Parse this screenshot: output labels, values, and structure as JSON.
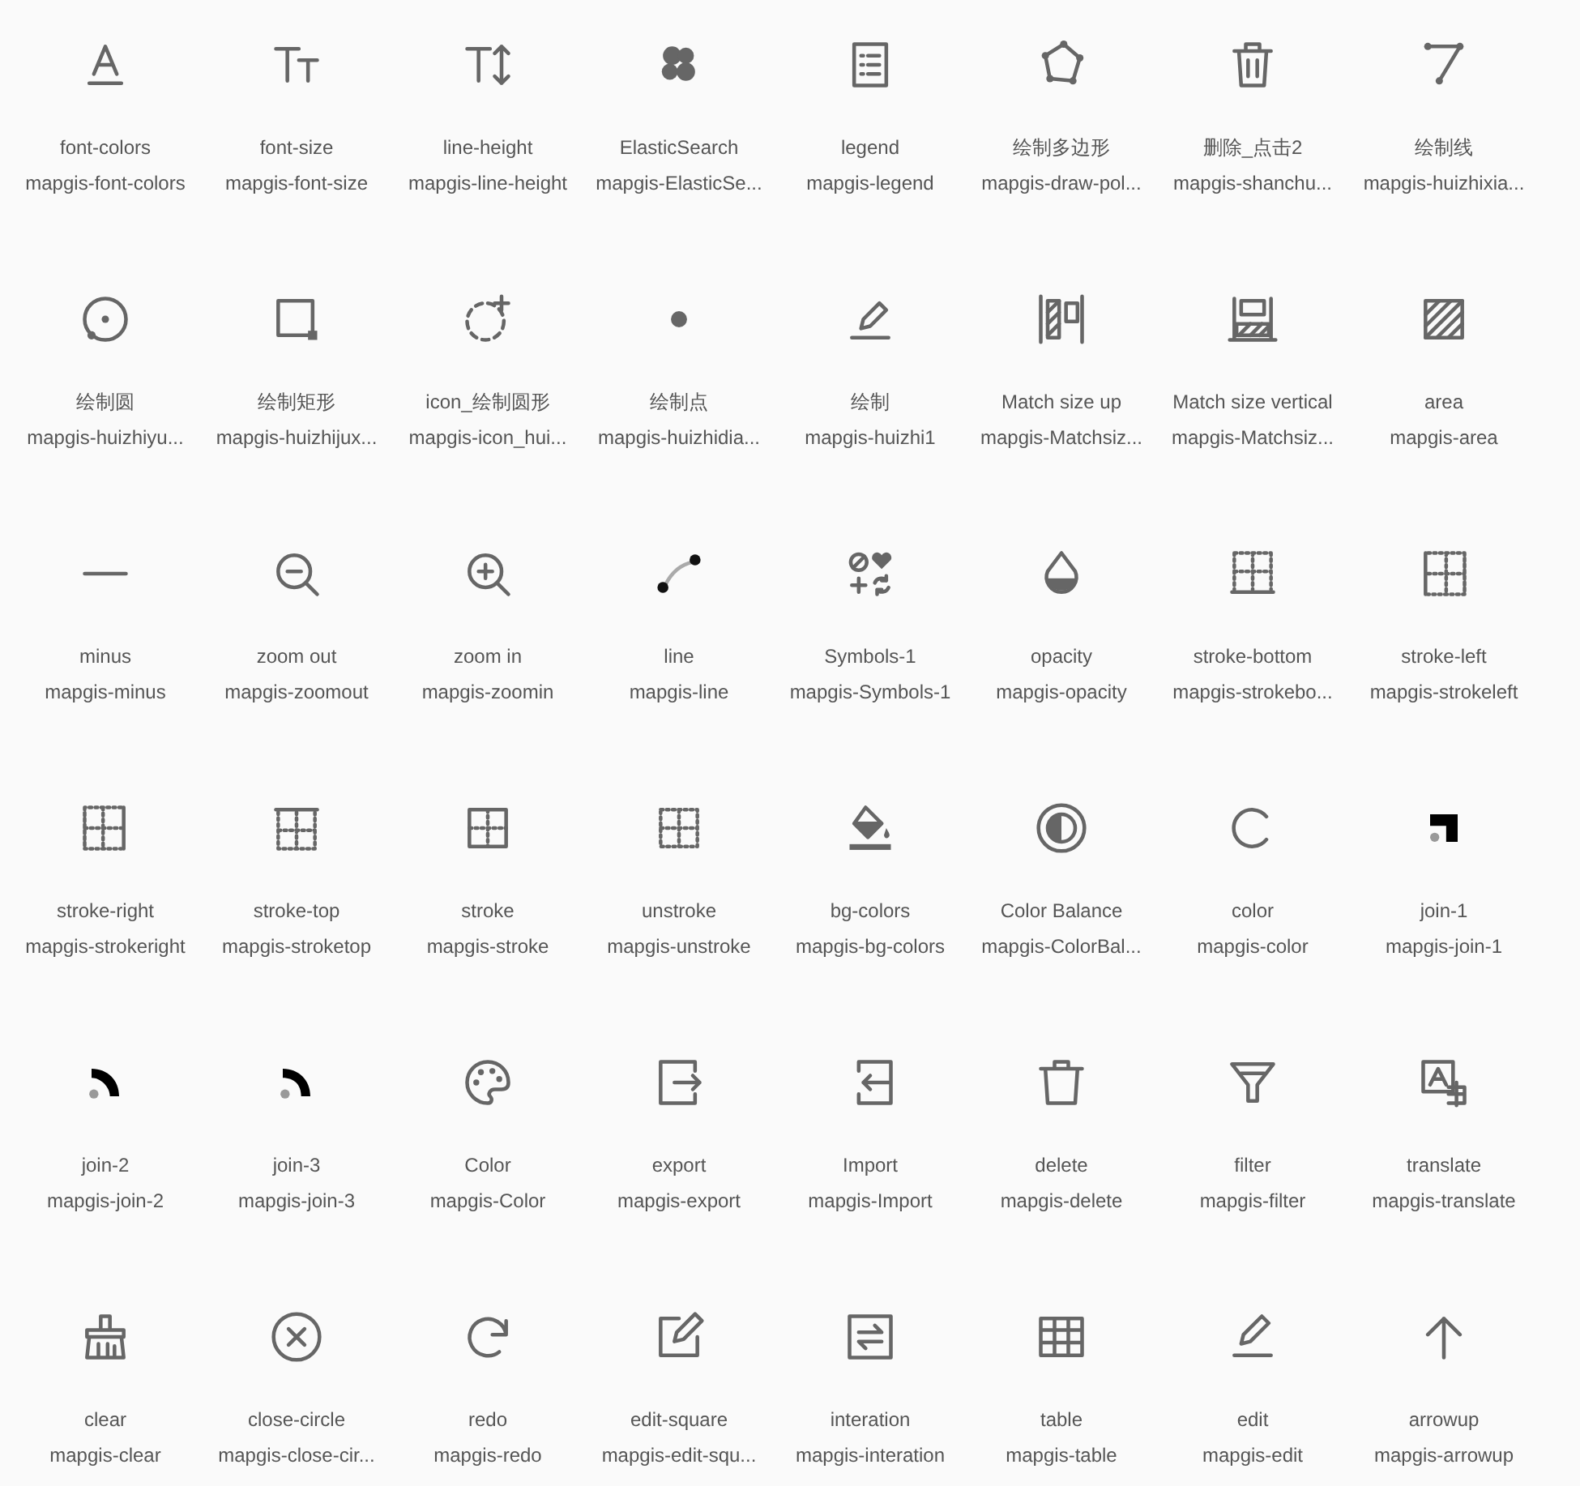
{
  "icons": [
    {
      "label": "font-colors",
      "class_name": "mapgis-font-colors"
    },
    {
      "label": "font-size",
      "class_name": "mapgis-font-size"
    },
    {
      "label": "line-height",
      "class_name": "mapgis-line-height"
    },
    {
      "label": "ElasticSearch",
      "class_name": "mapgis-ElasticSe..."
    },
    {
      "label": "legend",
      "class_name": "mapgis-legend"
    },
    {
      "label": "绘制多边形",
      "class_name": "mapgis-draw-pol..."
    },
    {
      "label": "删除_点击2",
      "class_name": "mapgis-shanchu..."
    },
    {
      "label": "绘制线",
      "class_name": "mapgis-huizhixia..."
    },
    {
      "label": "绘制圆",
      "class_name": "mapgis-huizhiyu..."
    },
    {
      "label": "绘制矩形",
      "class_name": "mapgis-huizhijux..."
    },
    {
      "label": "icon_绘制圆形",
      "class_name": "mapgis-icon_hui..."
    },
    {
      "label": "绘制点",
      "class_name": "mapgis-huizhidia..."
    },
    {
      "label": "绘制",
      "class_name": "mapgis-huizhi1"
    },
    {
      "label": "Match size up",
      "class_name": "mapgis-Matchsiz..."
    },
    {
      "label": "Match size vertical",
      "class_name": "mapgis-Matchsiz..."
    },
    {
      "label": "area",
      "class_name": "mapgis-area"
    },
    {
      "label": "minus",
      "class_name": "mapgis-minus"
    },
    {
      "label": "zoom out",
      "class_name": "mapgis-zoomout"
    },
    {
      "label": "zoom in",
      "class_name": "mapgis-zoomin"
    },
    {
      "label": "line",
      "class_name": "mapgis-line"
    },
    {
      "label": "Symbols-1",
      "class_name": "mapgis-Symbols-1"
    },
    {
      "label": "opacity",
      "class_name": "mapgis-opacity"
    },
    {
      "label": "stroke-bottom",
      "class_name": "mapgis-strokebo..."
    },
    {
      "label": "stroke-left",
      "class_name": "mapgis-strokeleft"
    },
    {
      "label": "stroke-right",
      "class_name": "mapgis-strokeright"
    },
    {
      "label": "stroke-top",
      "class_name": "mapgis-stroketop"
    },
    {
      "label": "stroke",
      "class_name": "mapgis-stroke"
    },
    {
      "label": "unstroke",
      "class_name": "mapgis-unstroke"
    },
    {
      "label": "bg-colors",
      "class_name": "mapgis-bg-colors"
    },
    {
      "label": "Color Balance",
      "class_name": "mapgis-ColorBal..."
    },
    {
      "label": "color",
      "class_name": "mapgis-color"
    },
    {
      "label": "join-1",
      "class_name": "mapgis-join-1"
    },
    {
      "label": "join-2",
      "class_name": "mapgis-join-2"
    },
    {
      "label": "join-3",
      "class_name": "mapgis-join-3"
    },
    {
      "label": "Color",
      "class_name": "mapgis-Color"
    },
    {
      "label": "export",
      "class_name": "mapgis-export"
    },
    {
      "label": "Import",
      "class_name": "mapgis-Import"
    },
    {
      "label": "delete",
      "class_name": "mapgis-delete"
    },
    {
      "label": "filter",
      "class_name": "mapgis-filter"
    },
    {
      "label": "translate",
      "class_name": "mapgis-translate"
    },
    {
      "label": "clear",
      "class_name": "mapgis-clear"
    },
    {
      "label": "close-circle",
      "class_name": "mapgis-close-cir..."
    },
    {
      "label": "redo",
      "class_name": "mapgis-redo"
    },
    {
      "label": "edit-square",
      "class_name": "mapgis-edit-squ..."
    },
    {
      "label": "interation",
      "class_name": "mapgis-interation"
    },
    {
      "label": "table",
      "class_name": "mapgis-table"
    },
    {
      "label": "edit",
      "class_name": "mapgis-edit"
    },
    {
      "label": "arrowup",
      "class_name": "mapgis-arrowup"
    }
  ]
}
